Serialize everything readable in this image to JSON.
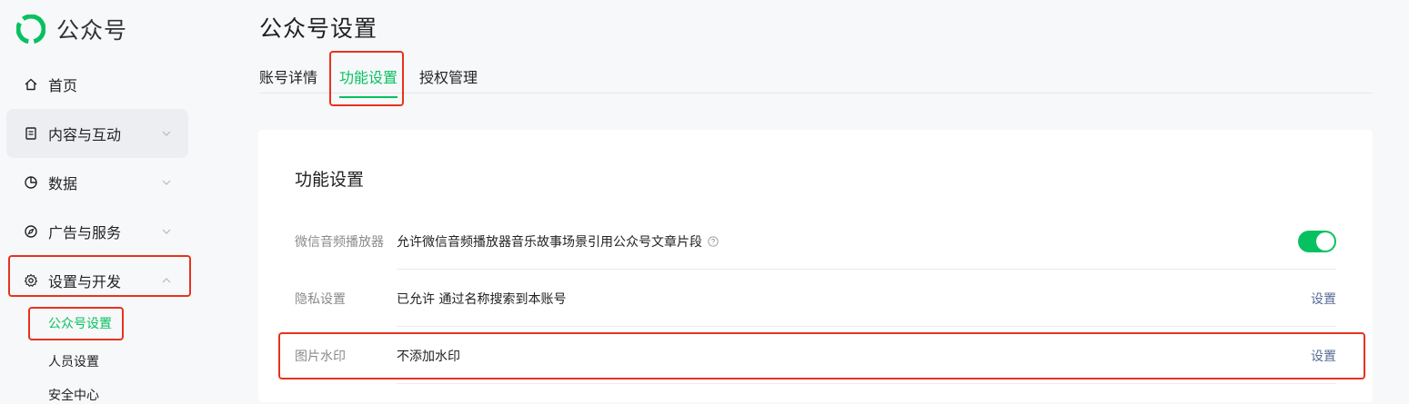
{
  "brand": {
    "name": "公众号",
    "icon": "wechat-official-account-logo-icon",
    "color": "#07c160"
  },
  "sidebar": {
    "items": [
      {
        "label": "首页",
        "icon": "home-icon"
      },
      {
        "label": "内容与互动",
        "icon": "document-icon"
      },
      {
        "label": "数据",
        "icon": "pie-chart-icon"
      },
      {
        "label": "广告与服务",
        "icon": "compass-icon"
      },
      {
        "label": "设置与开发",
        "icon": "gear-icon"
      }
    ],
    "sub_items": [
      {
        "label": "公众号设置"
      },
      {
        "label": "人员设置"
      },
      {
        "label": "安全中心"
      }
    ]
  },
  "page": {
    "title": "公众号设置",
    "tabs": [
      {
        "label": "账号详情"
      },
      {
        "label": "功能设置"
      },
      {
        "label": "授权管理"
      }
    ],
    "active_tab": "功能设置"
  },
  "card": {
    "title": "功能设置",
    "rows": [
      {
        "label": "微信音频播放器",
        "value": "允许微信音频播放器音乐故事场景引用公众号文章片段",
        "control": "toggle",
        "toggle_on": true
      },
      {
        "label": "隐私设置",
        "value": "已允许 通过名称搜索到本账号",
        "action": "设置"
      },
      {
        "label": "图片水印",
        "value": "不添加水印",
        "action": "设置"
      }
    ]
  },
  "colors": {
    "accent": "#07c160",
    "link": "#576b95",
    "highlight": "#e8321e"
  }
}
